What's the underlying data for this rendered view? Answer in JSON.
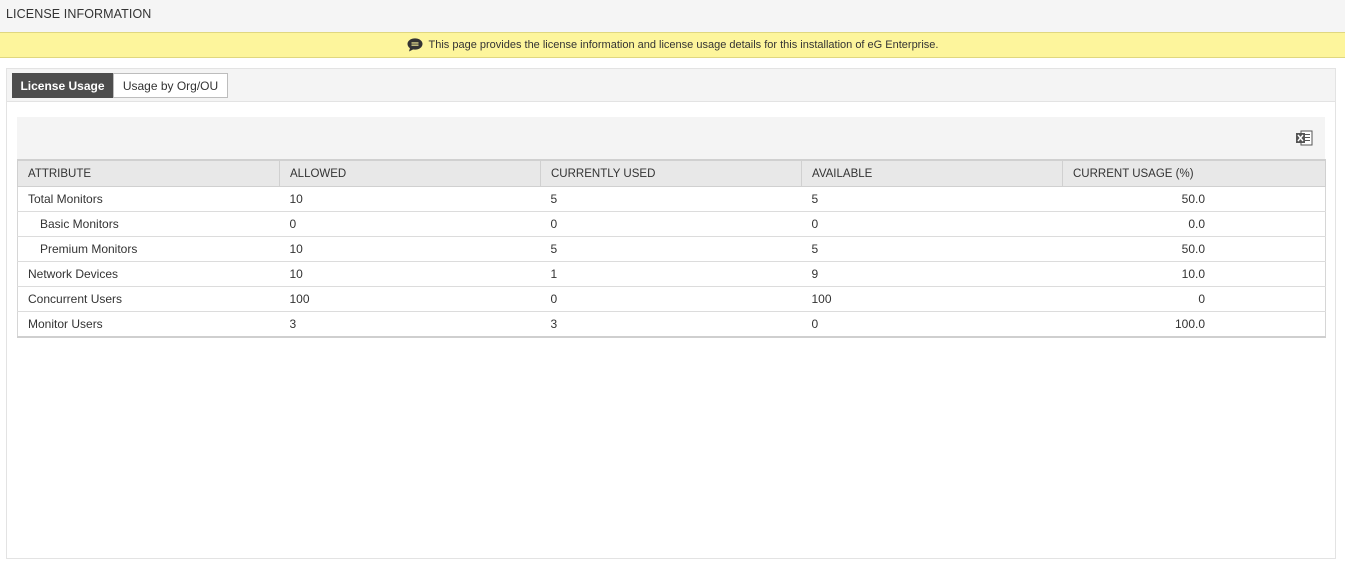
{
  "page": {
    "title": "LICENSE INFORMATION"
  },
  "banner": {
    "icon": "speech-bubble-icon",
    "text": "This page provides the license information and license usage details for this installation of eG Enterprise."
  },
  "tabs": [
    {
      "label": "License Usage",
      "active": true
    },
    {
      "label": "Usage by Org/OU",
      "active": false
    }
  ],
  "toolbar": {
    "export_icon": "excel-export-icon"
  },
  "table": {
    "columns": [
      "ATTRIBUTE",
      "ALLOWED",
      "CURRENTLY USED",
      "AVAILABLE",
      "CURRENT USAGE (%)"
    ],
    "rows": [
      {
        "attribute": "Total Monitors",
        "allowed": "10",
        "used": "5",
        "available": "5",
        "usage": "50.0",
        "indent": false
      },
      {
        "attribute": "Basic Monitors",
        "allowed": "0",
        "used": "0",
        "available": "0",
        "usage": "0.0",
        "indent": true
      },
      {
        "attribute": "Premium Monitors",
        "allowed": "10",
        "used": "5",
        "available": "5",
        "usage": "50.0",
        "indent": true
      },
      {
        "attribute": "Network Devices",
        "allowed": "10",
        "used": "1",
        "available": "9",
        "usage": "10.0",
        "indent": false
      },
      {
        "attribute": "Concurrent Users",
        "allowed": "100",
        "used": "0",
        "available": "100",
        "usage": "0",
        "indent": false
      },
      {
        "attribute": "Monitor Users",
        "allowed": "3",
        "used": "3",
        "available": "0",
        "usage": "100.0",
        "indent": false
      }
    ]
  },
  "colors": {
    "banner_bg": "#fdf59c",
    "active_tab_bg": "#4d4d4d",
    "header_bg": "#e8e8e8",
    "excel_green": "#1e7145"
  }
}
